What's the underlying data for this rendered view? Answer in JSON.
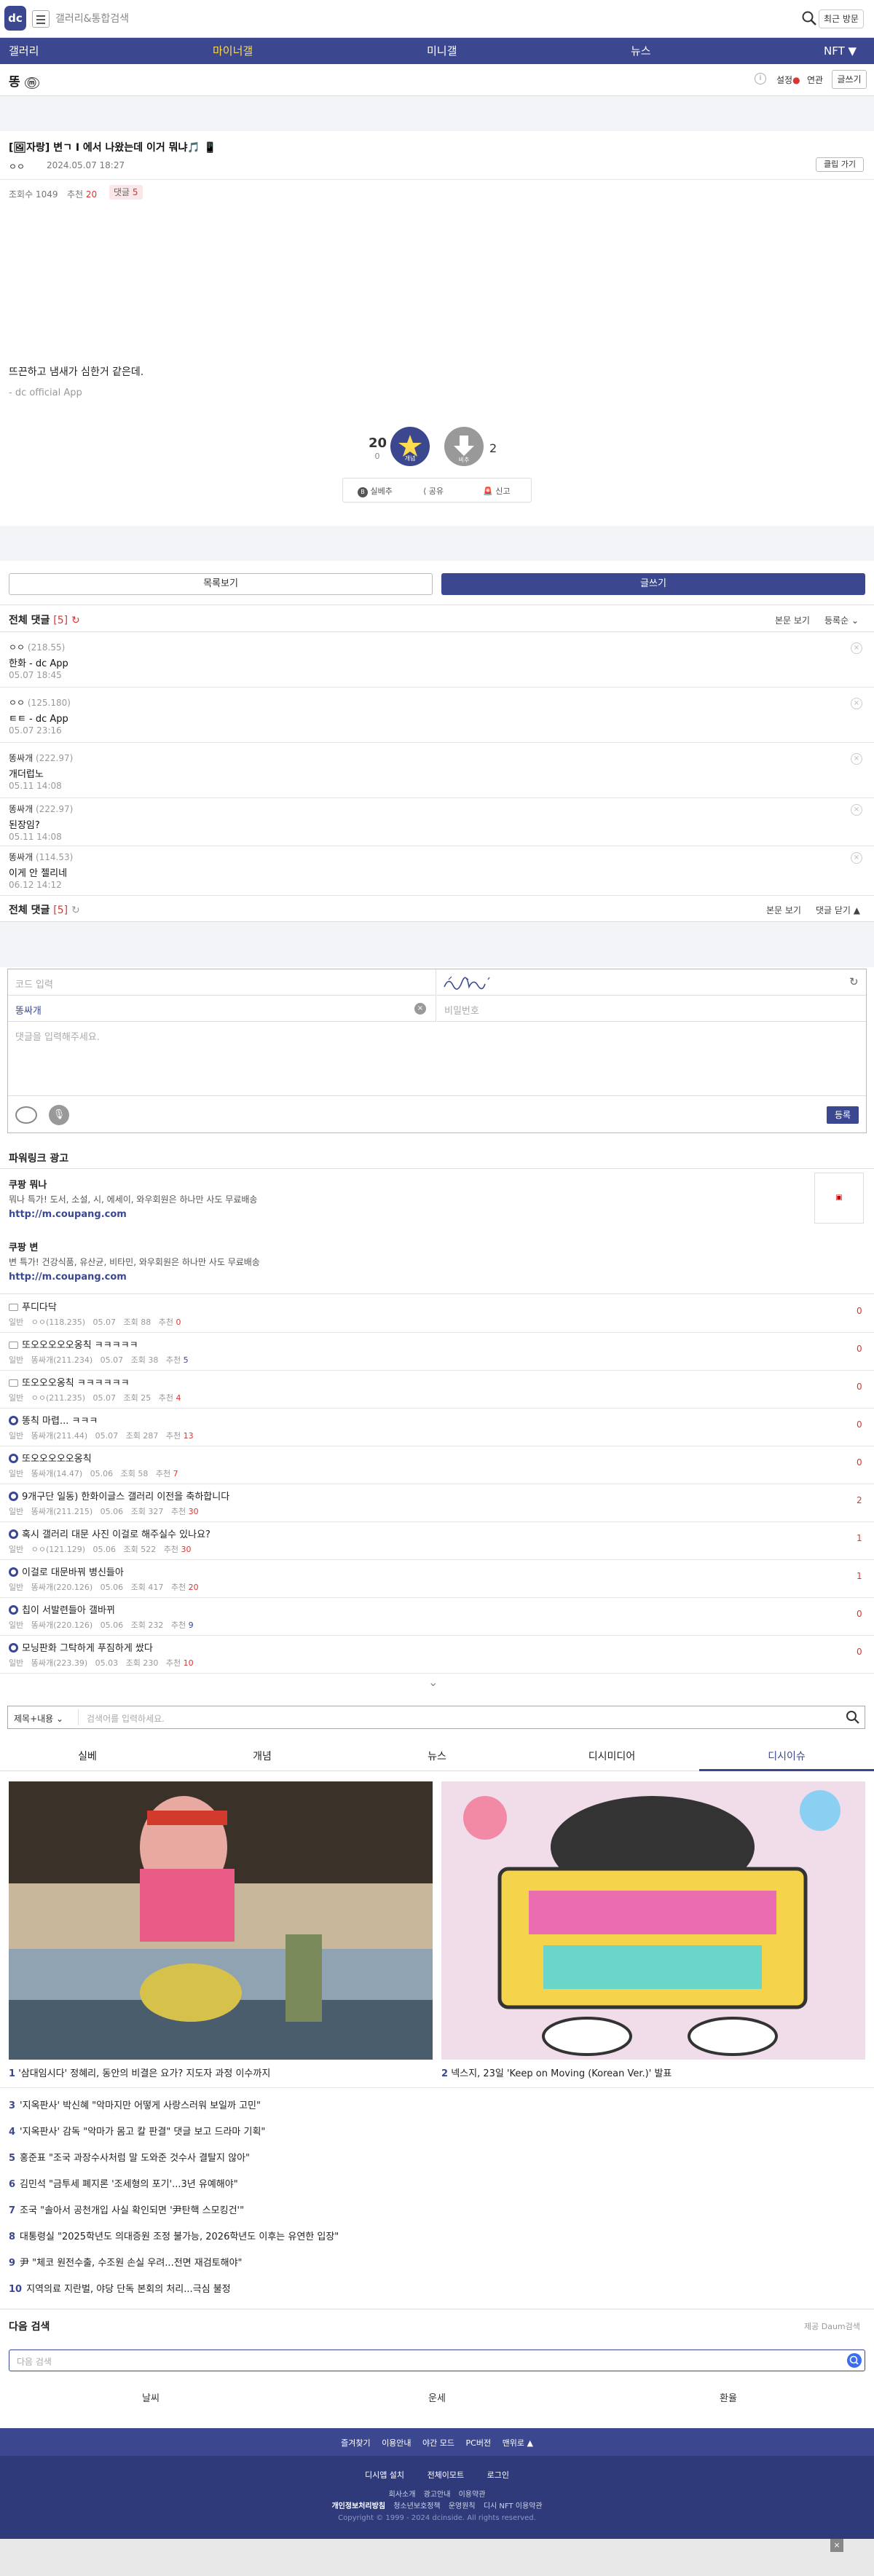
{
  "header": {
    "logo": "dc",
    "search_placeholder": "갤러리&통합검색",
    "recent_label": "최근 방문"
  },
  "nav": {
    "items": [
      "갤러리",
      "마이너갤",
      "미니갤",
      "뉴스",
      "NFT ▼"
    ],
    "active_index": 1
  },
  "gallery": {
    "name": "똥",
    "badge": "ⓜ",
    "settings_label": "설정",
    "related_label": "연관",
    "write_label": "글쓰기"
  },
  "post": {
    "title": "[🖼자랑] 변ㄱ I 에서 나왔는데 이거 뭐냐🎵 📱",
    "author": "ㅇㅇ",
    "date": "2024.05.07 18:27",
    "copy_link_label": "클립 가기",
    "views_label": "조회수 1049",
    "recommend_label": "추천",
    "recommend_count": "20",
    "comments_label": "댓글",
    "comments_count": "5",
    "body_text": "뜨끈하고 냄새가 심한거 같은데.",
    "signature": "- dc official App",
    "up_count": "20",
    "up_sub": "0",
    "up_label": "개념",
    "down_label": "비추",
    "down_count": "2",
    "actions": [
      "실베추",
      "공유",
      "신고"
    ]
  },
  "list_buttons": {
    "list": "목록보기",
    "write": "글쓰기"
  },
  "comments_header": {
    "title": "전체 댓글",
    "count": "[5]",
    "view_original": "본문 보기",
    "sort": "등록순",
    "collapse": "댓글 닫기 ▲"
  },
  "comments": [
    {
      "nick": "ㅇㅇ",
      "ip": "(218.55)",
      "text": "한화 - dc App",
      "date": "05.07 18:45"
    },
    {
      "nick": "ㅇㅇ",
      "ip": "(125.180)",
      "text": "ㅌㅌ - dc App",
      "date": "05.07 23:16"
    },
    {
      "nick": "똥싸개",
      "ip": "(222.97)",
      "text": "개더럽노",
      "date": "05.11 14:08"
    },
    {
      "nick": "똥싸개",
      "ip": "(222.97)",
      "text": "된장임?",
      "date": "05.11 14:08"
    },
    {
      "nick": "똥싸개",
      "ip": "(114.53)",
      "text": "이게 안 젤리네",
      "date": "06.12 14:12"
    }
  ],
  "comment_form": {
    "code_placeholder": "코드 입력",
    "nick_value": "똥싸개",
    "password_placeholder": "비밀번호",
    "content_placeholder": "댓글을 입력해주세요.",
    "submit_label": "등록"
  },
  "powerlink": {
    "title": "파워링크 광고",
    "ads": [
      {
        "title": "쿠팡 뭐나",
        "desc": "뭐나 특가! 도서, 소설, 시, 에세이, 와우회원은 하나만 사도 무료배송",
        "url": "http://m.coupang.com"
      },
      {
        "title": "쿠팡 변",
        "desc": "변 특가! 건강식품, 유산균, 비타민, 와우회원은 하나만 사도 무료배송",
        "url": "http://m.coupang.com"
      }
    ]
  },
  "post_list": [
    {
      "title": "푸디다닥",
      "icon": "img",
      "nick": "ㅇㅇ(118.235)",
      "date": "05.07",
      "views": "조회 88",
      "rec": "0",
      "cnt": "0"
    },
    {
      "title": "또오오오오오옹칙 ㅋㅋㅋㅋㅋ",
      "icon": "img",
      "nick": "똥싸개(211.234)",
      "date": "05.07",
      "views": "조회 38",
      "rec": "5",
      "cnt": "0"
    },
    {
      "title": "또오오오옹칙 ㅋㅋㅋㅋㅋㅋ",
      "icon": "img",
      "nick": "ㅇㅇ(211.235)",
      "date": "05.07",
      "views": "조회 25",
      "rec": "4",
      "cnt": "0"
    },
    {
      "title": "똥칙 마렵... ㅋㅋㅋ",
      "icon": "bold",
      "nick": "똥싸개(211.44)",
      "date": "05.07",
      "views": "조회 287",
      "rec": "13",
      "cnt": "0"
    },
    {
      "title": "또오오오오오옹칙",
      "icon": "bold",
      "nick": "똥싸개(14.47)",
      "date": "05.06",
      "views": "조회 58",
      "rec": "7",
      "cnt": "0"
    },
    {
      "title": "9개구단 일동) 한화이글스 갤러리 이전을 축하합니다",
      "icon": "bold",
      "nick": "똥싸개(211.215)",
      "date": "05.06",
      "views": "조회 327",
      "rec": "30",
      "cnt": "2"
    },
    {
      "title": "혹시 갤러리 대문 사진 이걸로 해주실수 있나요?",
      "icon": "bold",
      "nick": "ㅇㅇ(121.129)",
      "date": "05.06",
      "views": "조회 522",
      "rec": "30",
      "cnt": "1"
    },
    {
      "title": "이걸로 대문바꿔 병신들아",
      "icon": "bold",
      "nick": "똥싸개(220.126)",
      "date": "05.06",
      "views": "조회 417",
      "rec": "20",
      "cnt": "1"
    },
    {
      "title": "칩이 서발련들아 갤바뀌",
      "icon": "bold",
      "nick": "똥싸개(220.126)",
      "date": "05.06",
      "views": "조회 232",
      "rec": "9",
      "cnt": "0"
    },
    {
      "title": "모닝판화 그탁하게 푸짐하게 쌌다",
      "icon": "bold",
      "nick": "똥싸개(223.39)",
      "date": "05.03",
      "views": "조회 230",
      "rec": "10",
      "cnt": "0"
    }
  ],
  "search_bottom": {
    "type": "제목+내용",
    "placeholder": "검색어를 입력하세요."
  },
  "tabs": [
    "실베",
    "개념",
    "뉴스",
    "디시미디어",
    "디시이슈"
  ],
  "active_tab": 4,
  "feature": [
    {
      "num": "1",
      "title": "'삼대임시다' 정혜리, 동안의 비결은 요가? 지도자 과정 이수까지"
    },
    {
      "num": "2",
      "title": "넥스지, 23일 'Keep on Moving (Korean Ver.)' 발표"
    }
  ],
  "ranking": [
    {
      "num": "3",
      "title": "'지옥판사' 박신혜 \"악마지만 어떻게 사랑스러워 보일까 고민\""
    },
    {
      "num": "4",
      "title": "'지옥판사' 감독 \"악마가 몸고 칼 판결\" 댓글 보고 드라마 기획\""
    },
    {
      "num": "5",
      "title": "홍준표 \"조국 과장수사처럼 말 도와준 것수사 결탈지 않아\""
    },
    {
      "num": "6",
      "title": "김민석 \"금투세 폐지론 '조세형의 포기'...3년 유예해야\""
    },
    {
      "num": "7",
      "title": "조국 \"솔아서 공천개입 사실 확인되면 '尹탄핵 스모킹건'\""
    },
    {
      "num": "8",
      "title": "대통령실 \"2025학년도 의대증원 조정 불가능, 2026학년도 이후는 유연한 입장\""
    },
    {
      "num": "9",
      "title": "尹 \"체코 원전수출, 수조원 손실 우려...전면 재검토해야\""
    },
    {
      "num": "10",
      "title": "지역의료 지란벌, 야당 단독 본회의 처리...극심 불정"
    }
  ],
  "next_search": {
    "title": "다음 검색",
    "provider": "제공 Daum검색",
    "placeholder": "다음 검색",
    "suggestions": [
      "날씨",
      "운세",
      "환율"
    ]
  },
  "footer": {
    "row1": [
      "즐겨찾기",
      "이용안내",
      "야간 모드",
      "PC버전",
      "맨위로 ▲"
    ],
    "row2": [
      "디시앱 설치",
      "전체이모트",
      "로그인"
    ],
    "row3": [
      "회사소개",
      "광고안내",
      "이용약관"
    ],
    "row4": [
      "개인정보처리방침",
      "청소년보호정책",
      "운영원칙",
      "디시 NFT 이용약관"
    ],
    "copyright": "Copyright © 1999 - 2024 dcinside. All rights reserved."
  },
  "colors": {
    "brand": "#3b4890",
    "accent_yellow": "#ffda4f",
    "red": "#d33",
    "grey_bg": "#f2f4f7"
  }
}
